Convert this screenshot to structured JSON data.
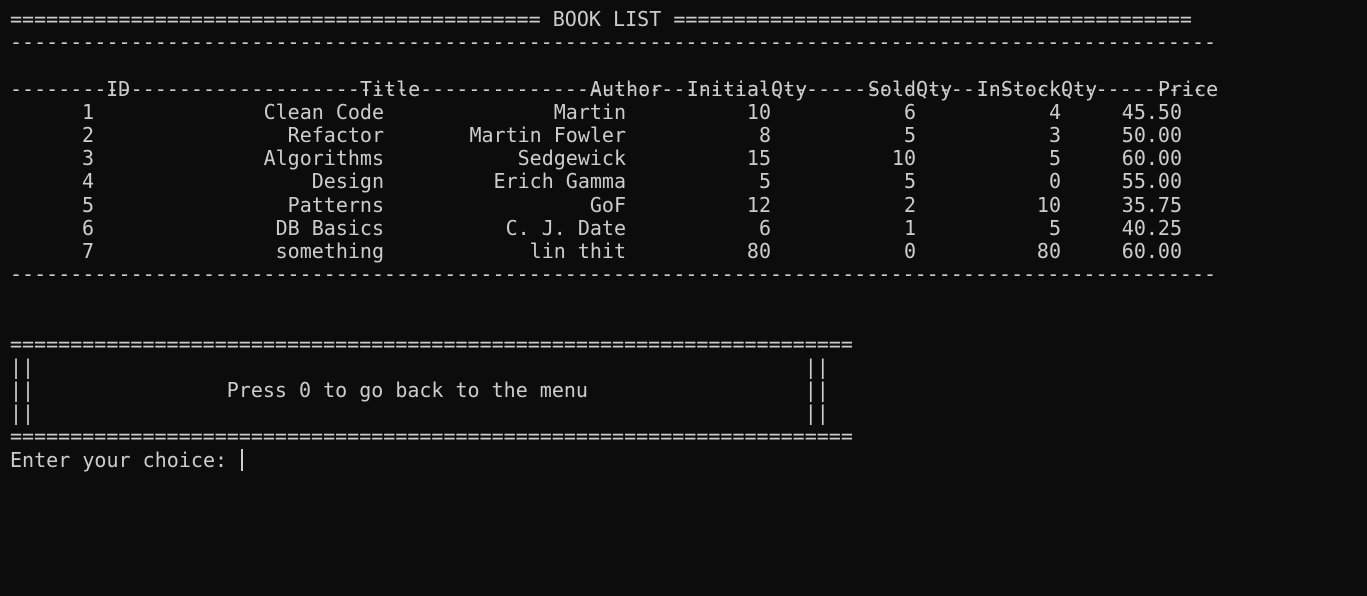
{
  "book_list": {
    "title_line": "============================================ BOOK LIST ===========================================",
    "divider": "----------------------------------------------------------------------------------------------------",
    "headers": {
      "id": "ID",
      "title": "Title",
      "author": "Author",
      "initial_qty": "InitialQty",
      "sold_qty": "SoldQty",
      "in_stock_qty": "InStockQty",
      "price": "Price"
    },
    "rows": [
      {
        "id": "1",
        "title": "Clean Code",
        "author": "Martin",
        "initial_qty": "10",
        "sold_qty": "6",
        "in_stock_qty": "4",
        "price": "45.50"
      },
      {
        "id": "2",
        "title": "Refactor",
        "author": "Martin Fowler",
        "initial_qty": "8",
        "sold_qty": "5",
        "in_stock_qty": "3",
        "price": "50.00"
      },
      {
        "id": "3",
        "title": "Algorithms",
        "author": "Sedgewick",
        "initial_qty": "15",
        "sold_qty": "10",
        "in_stock_qty": "5",
        "price": "60.00"
      },
      {
        "id": "4",
        "title": "Design",
        "author": "Erich Gamma",
        "initial_qty": "5",
        "sold_qty": "5",
        "in_stock_qty": "0",
        "price": "55.00"
      },
      {
        "id": "5",
        "title": "Patterns",
        "author": "GoF",
        "initial_qty": "12",
        "sold_qty": "2",
        "in_stock_qty": "10",
        "price": "35.75"
      },
      {
        "id": "6",
        "title": "DB Basics",
        "author": "C. J. Date",
        "initial_qty": "6",
        "sold_qty": "1",
        "in_stock_qty": "5",
        "price": "40.25"
      },
      {
        "id": "7",
        "title": "something",
        "author": "lin thit",
        "initial_qty": "80",
        "sold_qty": "0",
        "in_stock_qty": "80",
        "price": "60.00"
      }
    ]
  },
  "menu_box": {
    "border": "======================================================================",
    "side_empty": "||                                                                ||",
    "message_line": "||                Press 0 to go back to the menu                  ||"
  },
  "prompt": {
    "label": "Enter your choice: "
  }
}
